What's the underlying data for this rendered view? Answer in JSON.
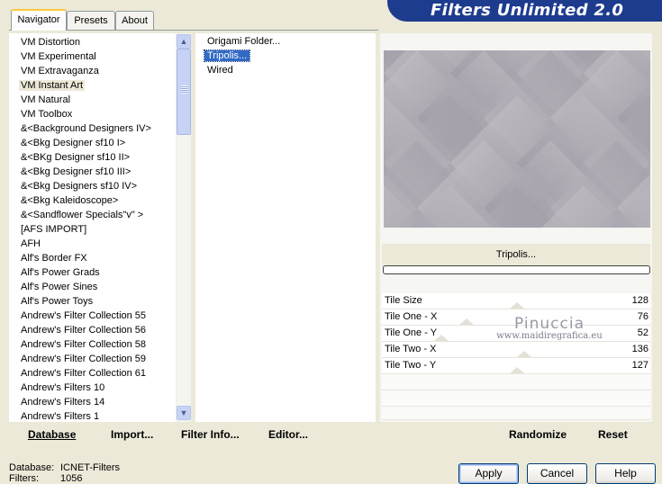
{
  "tabs": [
    {
      "label": "Navigator",
      "active": true
    },
    {
      "label": "Presets",
      "active": false
    },
    {
      "label": "About",
      "active": false
    }
  ],
  "app_title": "Filters Unlimited 2.0",
  "categories": [
    {
      "label": "VM Distortion",
      "selected": false
    },
    {
      "label": "VM Experimental",
      "selected": false
    },
    {
      "label": "VM Extravaganza",
      "selected": false
    },
    {
      "label": "VM Instant Art",
      "selected": true
    },
    {
      "label": "VM Natural",
      "selected": false
    },
    {
      "label": "VM Toolbox",
      "selected": false
    },
    {
      "label": "&<Background Designers IV>",
      "selected": false
    },
    {
      "label": "&<Bkg Designer sf10 I>",
      "selected": false
    },
    {
      "label": "&<BKg Designer sf10 II>",
      "selected": false
    },
    {
      "label": "&<Bkg Designer sf10 III>",
      "selected": false
    },
    {
      "label": "&<Bkg Designers sf10 IV>",
      "selected": false
    },
    {
      "label": "&<Bkg Kaleidoscope>",
      "selected": false
    },
    {
      "label": "&<Sandflower Specials\"v\" >",
      "selected": false
    },
    {
      "label": "[AFS IMPORT]",
      "selected": false
    },
    {
      "label": "AFH",
      "selected": false
    },
    {
      "label": "Alf's Border FX",
      "selected": false
    },
    {
      "label": "Alf's Power Grads",
      "selected": false
    },
    {
      "label": "Alf's Power Sines",
      "selected": false
    },
    {
      "label": "Alf's Power Toys",
      "selected": false
    },
    {
      "label": "Andrew's Filter Collection 55",
      "selected": false
    },
    {
      "label": "Andrew's Filter Collection 56",
      "selected": false
    },
    {
      "label": "Andrew's Filter Collection 58",
      "selected": false
    },
    {
      "label": "Andrew's Filter Collection 59",
      "selected": false
    },
    {
      "label": "Andrew's Filter Collection 61",
      "selected": false
    },
    {
      "label": "Andrew's Filters 10",
      "selected": false
    },
    {
      "label": "Andrew's Filters 14",
      "selected": false
    },
    {
      "label": "Andrew's Filters 1",
      "selected": false
    }
  ],
  "filters": [
    {
      "label": "Origami Folder...",
      "selected": false
    },
    {
      "label": "Tripolis...",
      "selected": true
    },
    {
      "label": "Wired",
      "selected": false
    }
  ],
  "current_filter": "Tripolis...",
  "progress": 0,
  "params": [
    {
      "label": "Tile Size",
      "value": "128",
      "level": 0.5
    },
    {
      "label": "Tile One - X",
      "value": "76",
      "level": 0.3
    },
    {
      "label": "Tile One - Y",
      "value": "52",
      "level": 0.2
    },
    {
      "label": "Tile Two - X",
      "value": "136",
      "level": 0.53
    },
    {
      "label": "Tile Two - Y",
      "value": "127",
      "level": 0.5
    }
  ],
  "watermark": {
    "title": "Pinuccia",
    "url": "www.maidiregrafica.eu"
  },
  "actions": {
    "database": "Database",
    "import": "Import...",
    "filter_info": "Filter Info...",
    "editor": "Editor...",
    "randomize": "Randomize",
    "reset": "Reset"
  },
  "status": {
    "database_label": "Database:",
    "database_value": "ICNET-Filters",
    "filters_label": "Filters:",
    "filters_value": "1056"
  },
  "buttons": {
    "apply": "Apply",
    "cancel": "Cancel",
    "help": "Help"
  },
  "colors": {
    "banner": "#1d3c8e",
    "selection": "#316ac5",
    "window_bg": "#ece9d8",
    "preview_light": "#c9c5c8",
    "preview_dark": "#8c8896"
  }
}
